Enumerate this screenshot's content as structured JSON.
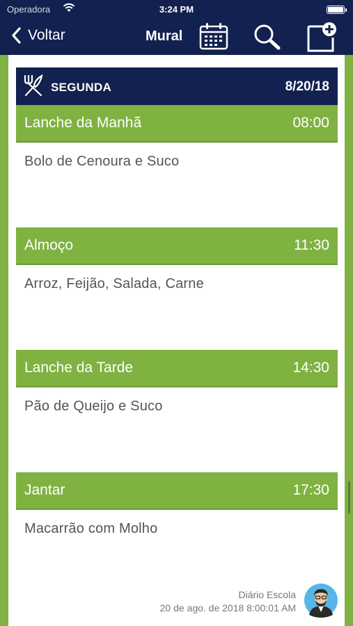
{
  "status": {
    "carrier": "Operadora",
    "time": "3:24 PM"
  },
  "nav": {
    "back_label": "Voltar",
    "title": "Mural"
  },
  "day": {
    "name": "SEGUNDA",
    "date": "8/20/18"
  },
  "meals": [
    {
      "name": "Lanche da Manhã",
      "time": "08:00",
      "description": "Bolo de Cenoura e Suco"
    },
    {
      "name": "Almoço",
      "time": "11:30",
      "description": "Arroz, Feijão, Salada, Carne"
    },
    {
      "name": "Lanche da Tarde",
      "time": "14:30",
      "description": "Pão de Queijo e Suco"
    },
    {
      "name": "Jantar",
      "time": "17:30",
      "description": "Macarrão com Molho"
    }
  ],
  "footer": {
    "author": "Diário Escola",
    "timestamp": "20 de ago. de 2018 8:00:01 AM"
  },
  "colors": {
    "navy": "#12214f",
    "green": "#7fb241"
  },
  "icons": [
    "chevron-left-icon",
    "calendar-icon",
    "search-icon",
    "new-post-icon",
    "fork-knife-icon",
    "avatar"
  ]
}
